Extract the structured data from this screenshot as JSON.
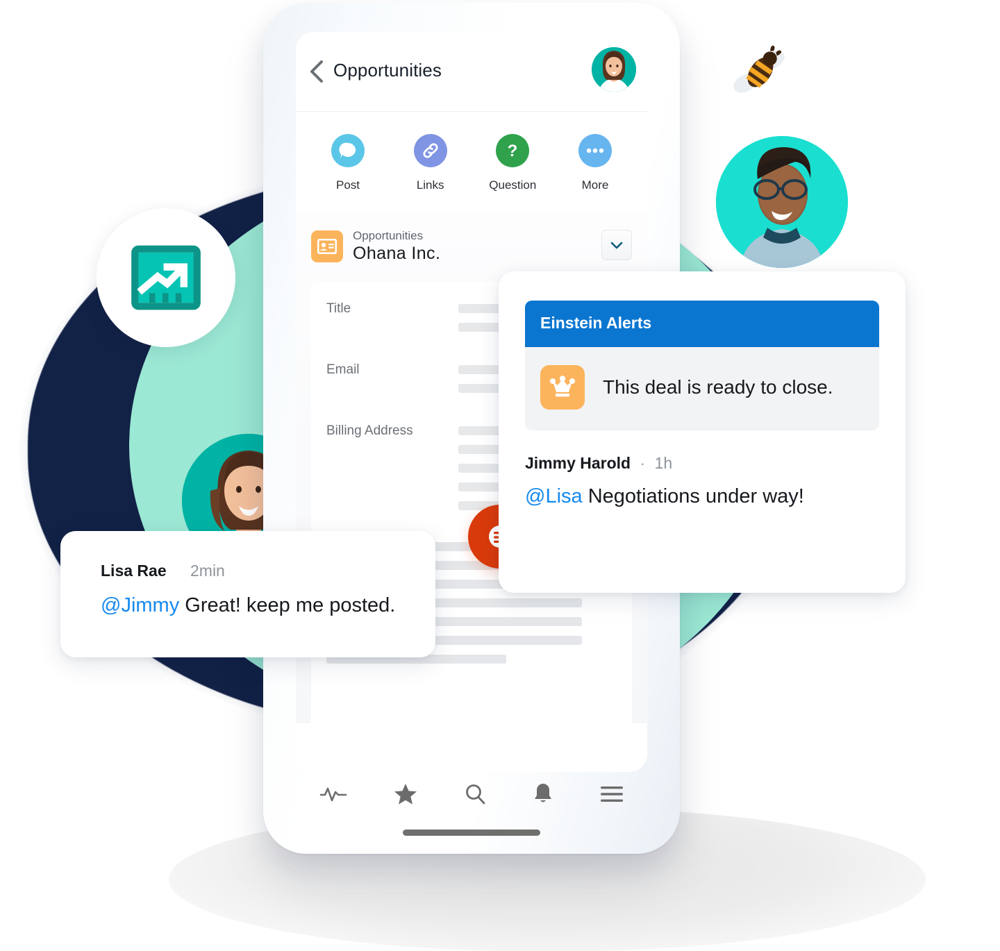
{
  "app": {
    "title": "Opportunities",
    "back_icon": "chevron-left-icon",
    "user_avatar": "woman-avatar"
  },
  "quick_actions": [
    {
      "label": "Post",
      "icon": "chat-bubble-icon",
      "color": "#5bc6e8"
    },
    {
      "label": "Links",
      "icon": "link-chain-icon",
      "color": "#7f94e3"
    },
    {
      "label": "Question",
      "icon": "question-mark-icon",
      "color": "#30a24c"
    },
    {
      "label": "More",
      "icon": "ellipsis-icon",
      "color": "#67b5ef"
    }
  ],
  "record": {
    "object_label": "Opportunities",
    "name": "Ohana  Inc.",
    "icon": "contact-card-icon",
    "icon_color": "#fbb45c",
    "expand_icon": "chevron-down-icon",
    "fields": [
      {
        "label": "Title"
      },
      {
        "label": "Email"
      },
      {
        "label": "Billing Address"
      }
    ]
  },
  "fab": {
    "icon": "post-bubble-icon",
    "color": "#d93a0b"
  },
  "bottom_nav": [
    {
      "name": "activity",
      "icon": "pulse-icon"
    },
    {
      "name": "favorites",
      "icon": "star-icon"
    },
    {
      "name": "search",
      "icon": "search-icon"
    },
    {
      "name": "notifications",
      "icon": "bell-icon"
    },
    {
      "name": "menu",
      "icon": "hamburger-menu-icon"
    }
  ],
  "einstein_card": {
    "banner_title": "Einstein Alerts",
    "banner_color": "#0b76d0",
    "alert_icon": "crown-icon",
    "alert_icon_color": "#fbb45c",
    "alert_text": "This deal is ready to close.",
    "post": {
      "author": "Jimmy Harold",
      "separator": "·",
      "time": "1h",
      "mention": "@Lisa",
      "message": " Negotiations under way!",
      "mention_color": "#1589ee"
    }
  },
  "lisa_card": {
    "author": "Lisa Rae",
    "time": "2min",
    "mention": "@Jimmy",
    "message": " Great! keep me posted.",
    "mention_color": "#1589ee"
  },
  "decor": {
    "chart_icon": "trending-chart-icon",
    "chart_icon_color": "#06c4b4",
    "bee": "bee-icon",
    "man_avatar": "man-with-glasses-avatar",
    "woman_avatar": "woman-avatar",
    "navy_blob_color": "#122146",
    "mint_blob_color": "#9be8d4"
  }
}
